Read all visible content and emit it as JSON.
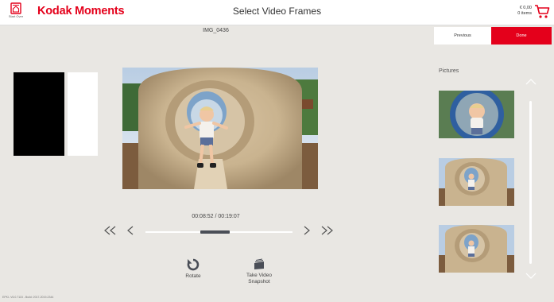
{
  "header": {
    "start_over_label": "Start Over",
    "brand": "Kodak Moments",
    "title": "Select Video Frames",
    "cart_amount": "€ 0,00",
    "cart_items": "0 items"
  },
  "nav": {
    "previous_label": "Previous",
    "done_label": "Done"
  },
  "video": {
    "filename": "IMG_0436",
    "timecode": "00:08:52 / 00:19:07",
    "progress": 0.41
  },
  "tools": {
    "rotate_label": "Rotate",
    "snapshot_label_line1": "Take Video",
    "snapshot_label_line2": "Snapshot"
  },
  "sidebar": {
    "pictures_label": "Pictures",
    "thumbnail_count": 3
  },
  "footer": {
    "version": "EPKI- V6.0.7115 - Build: 2017-2019-2344"
  },
  "colors": {
    "accent": "#e4001b",
    "background": "#e9e7e3"
  }
}
